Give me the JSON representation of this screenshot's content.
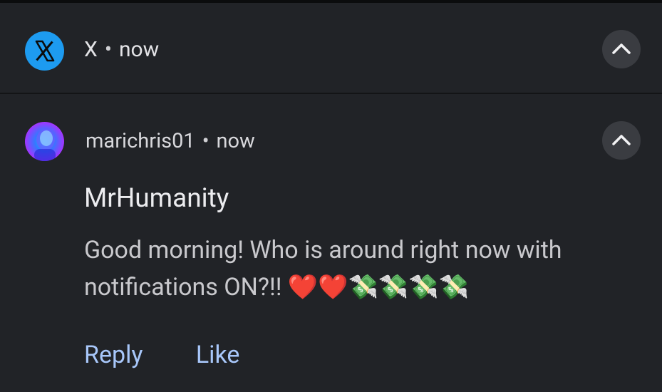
{
  "group": {
    "app_name": "X",
    "separator": "•",
    "time": "now"
  },
  "notification": {
    "sender": "marichris01",
    "separator": "•",
    "time": "now",
    "title": "MrHumanity",
    "body_text": "Good morning! Who is around right now with notifications ON?!! ",
    "body_emoji": "❤️❤️💸💸💸💸"
  },
  "actions": [
    {
      "label": "Reply"
    },
    {
      "label": "Like"
    }
  ],
  "colors": {
    "panel_bg": "#212327",
    "app_icon_bg": "#1d9bf0",
    "action_text": "#a8c7fa",
    "expand_button_bg": "#3a3c41"
  },
  "icons": {
    "app": "x-logo-icon",
    "expand": "chevron-up-icon",
    "avatar": "user-avatar"
  }
}
